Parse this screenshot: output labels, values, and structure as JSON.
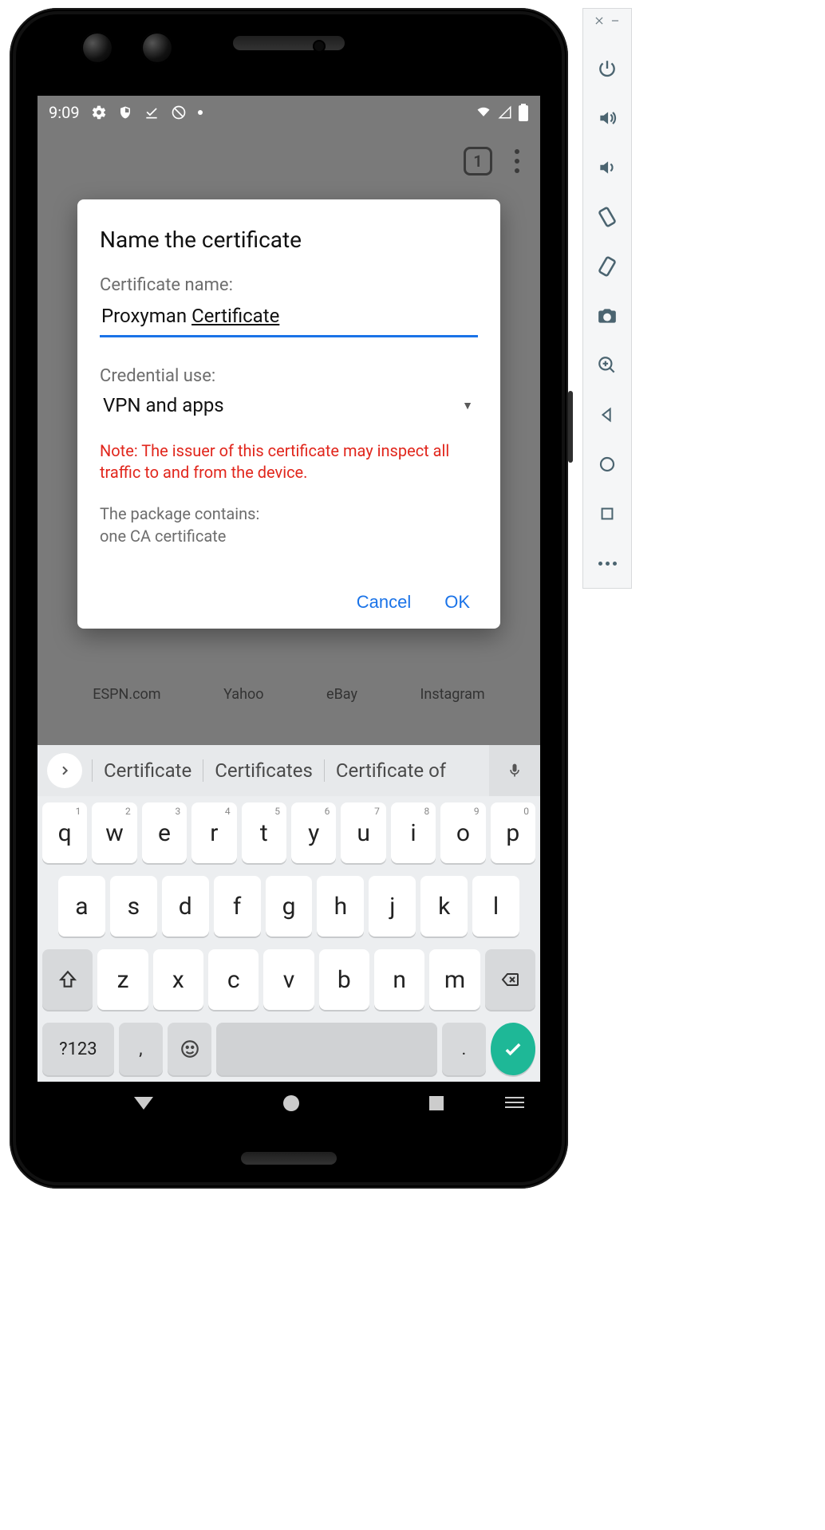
{
  "status_bar": {
    "time": "9:09",
    "icons_left": [
      "settings-icon",
      "shield-icon",
      "download-done-icon",
      "no-sync-icon",
      "dot-icon"
    ],
    "icons_right": [
      "wifi-icon",
      "cell-signal-icon",
      "battery-icon"
    ]
  },
  "browser": {
    "tab_count": "1",
    "shortcuts": [
      "ESPN.com",
      "Yahoo",
      "eBay",
      "Instagram"
    ]
  },
  "dialog": {
    "title": "Name the certificate",
    "cert_name_label": "Certificate name:",
    "cert_name_value": "Proxyman Certificate",
    "credential_use_label": "Credential use:",
    "credential_use_value": "VPN and apps",
    "warning": "Note: The issuer of this certificate may inspect all traffic to and from the device.",
    "package_line1": "The package contains:",
    "package_line2": "one CA certificate",
    "cancel": "Cancel",
    "ok": "OK"
  },
  "keyboard": {
    "suggestions": [
      "Certificate",
      "Certificates",
      "Certificate of"
    ],
    "row1": [
      {
        "k": "q",
        "n": "1"
      },
      {
        "k": "w",
        "n": "2"
      },
      {
        "k": "e",
        "n": "3"
      },
      {
        "k": "r",
        "n": "4"
      },
      {
        "k": "t",
        "n": "5"
      },
      {
        "k": "y",
        "n": "6"
      },
      {
        "k": "u",
        "n": "7"
      },
      {
        "k": "i",
        "n": "8"
      },
      {
        "k": "o",
        "n": "9"
      },
      {
        "k": "p",
        "n": "0"
      }
    ],
    "row2": [
      "a",
      "s",
      "d",
      "f",
      "g",
      "h",
      "j",
      "k",
      "l"
    ],
    "row3": [
      "z",
      "x",
      "c",
      "v",
      "b",
      "n",
      "m"
    ],
    "symbols_key": "?123",
    "comma": ",",
    "period": "."
  },
  "emulator_toolbar": {
    "buttons": [
      "close",
      "minimize",
      "power",
      "volume-up",
      "volume-down",
      "rotate-left",
      "rotate-right",
      "camera",
      "zoom",
      "back",
      "home",
      "overview",
      "more"
    ]
  }
}
